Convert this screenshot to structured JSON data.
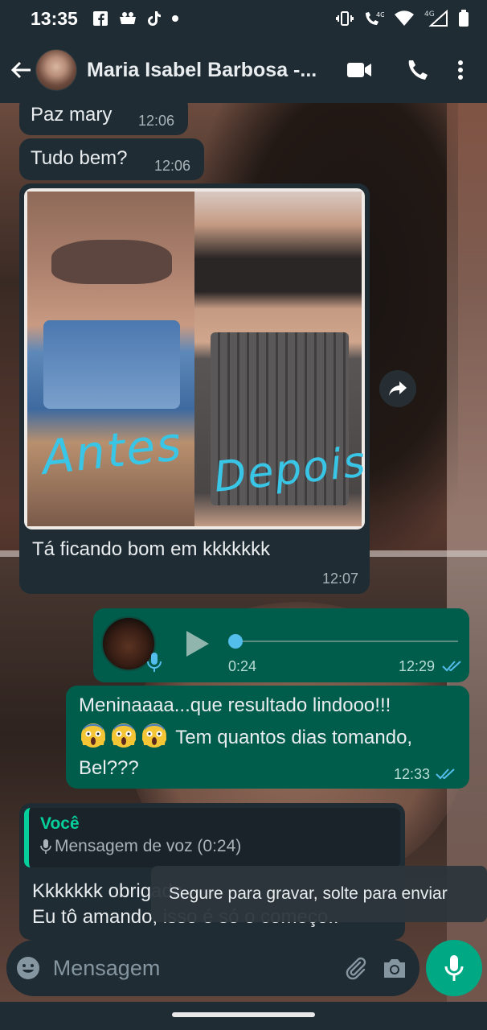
{
  "status_bar": {
    "time": "13:35",
    "left_icons": [
      "facebook-icon",
      "tinder-icon",
      "tiktok-icon",
      "dot-icon"
    ],
    "right_icons": [
      "vibrate-icon",
      "wifi-call-icon",
      "wifi-icon",
      "signal-icon",
      "battery-icon"
    ],
    "network_label_1": "4G",
    "network_label_2": "4G"
  },
  "header": {
    "contact_name": "Maria Isabel Barbosa -...",
    "accent": "#1f2c34"
  },
  "messages": {
    "m1": {
      "text": "Paz mary",
      "time": "12:06"
    },
    "m2": {
      "text": "Tudo bem?",
      "time": "12:06"
    },
    "m3": {
      "caption": "Tá ficando bom em kkkkkkk",
      "time": "12:07",
      "image_labels": {
        "left": "Antes",
        "right": "Depois"
      }
    },
    "m4": {
      "duration": "0:24",
      "time": "12:29",
      "progress": 0
    },
    "m5": {
      "text_line1": "Meninaaaa...que resultado lindooo!!!",
      "text_line2_after_emoji": "Tem quantos dias tomando,",
      "text_line3": "Bel???",
      "emojis": [
        "screaming-face",
        "screaming-face",
        "screaming-face"
      ],
      "time": "12:33"
    },
    "m6": {
      "quote_author": "Você",
      "quote_text": "Mensagem de voz (0:24)",
      "text_line1": "Kkkkkkk obrigada",
      "text_line2": "Eu tô amando, isso é só o começo.."
    }
  },
  "tooltip": {
    "text": "Segure para gravar, solte para enviar"
  },
  "input": {
    "placeholder": "Mensagem"
  },
  "colors": {
    "incoming_bubble": "#1f2c34",
    "outgoing_bubble": "#005c4b",
    "accent_green": "#00a884",
    "read_ticks": "#53bdeb"
  }
}
